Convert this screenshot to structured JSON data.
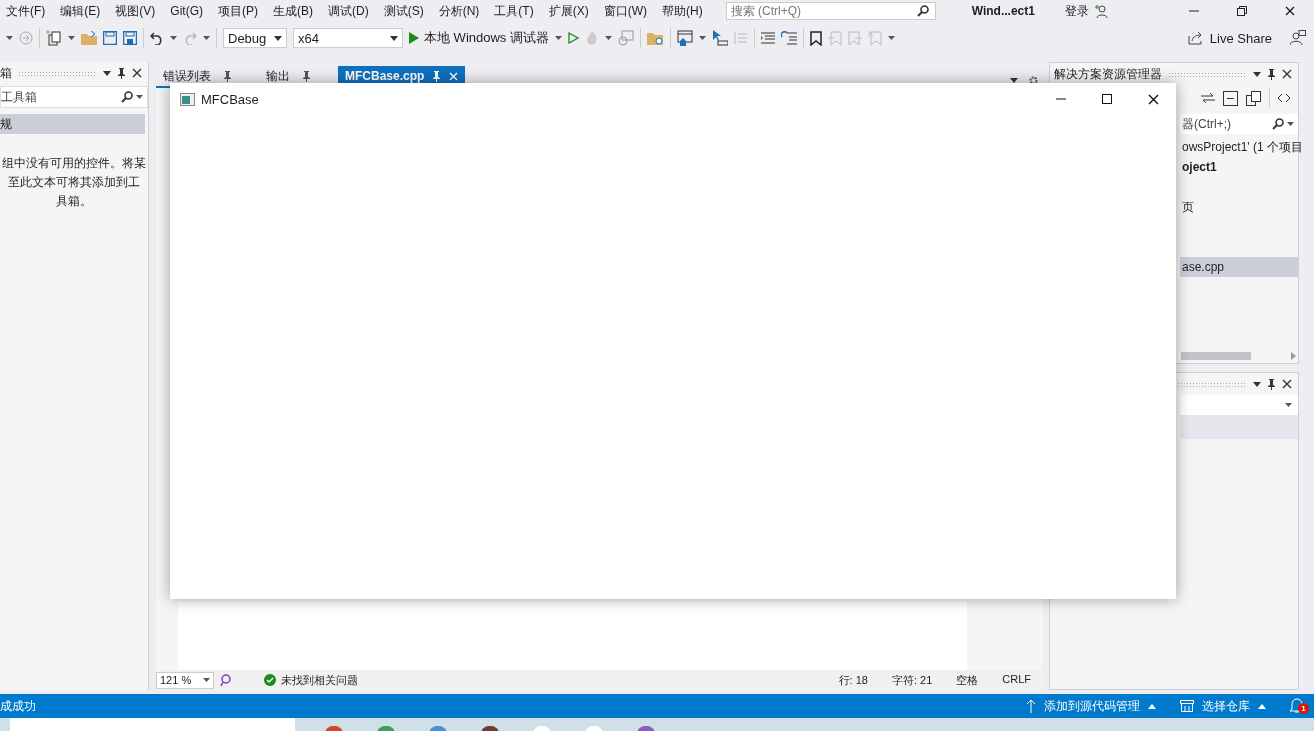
{
  "menu": [
    "文件(F)",
    "编辑(E)",
    "视图(V)",
    "Git(G)",
    "项目(P)",
    "生成(B)",
    "调试(D)",
    "测试(S)",
    "分析(N)",
    "工具(T)",
    "扩展(X)",
    "窗口(W)",
    "帮助(H)"
  ],
  "search": {
    "placeholder": "搜索 (Ctrl+Q)"
  },
  "window_title": "Wind...ect1",
  "sign_in": "登录",
  "toolbar": {
    "configuration": "Debug",
    "platform": "x64",
    "run": "本地 Windows 调试器",
    "live_share": "Live Share"
  },
  "toolbox": {
    "title": "箱",
    "search_placeholder": "工具箱",
    "group": "规",
    "message_lines": [
      "组中没有可用的控件。将某",
      "至此文本可将其添加到工",
      "具箱。"
    ]
  },
  "editor": {
    "tabs": [
      {
        "label": "错误列表",
        "selected": false
      },
      {
        "label": "输出",
        "selected": false
      },
      {
        "label": "MFCBase.cpp",
        "selected": true
      }
    ],
    "zoom": "121 %",
    "issues": "未找到相关问题",
    "line": "行: 18",
    "char": "字符: 21",
    "spacing": "空格",
    "line_ending": "CRLF"
  },
  "solution_explorer": {
    "title": "解决方案资源管理器",
    "search_placeholder": "器(Ctrl+;)",
    "items": [
      {
        "label": "owsProject1' (1 个项目",
        "bold": false,
        "selected": false
      },
      {
        "label": "oject1",
        "bold": true,
        "selected": false
      },
      {
        "label": "页",
        "bold": false,
        "selected": false
      },
      {
        "label": "ase.cpp",
        "bold": false,
        "selected": true
      }
    ]
  },
  "floating_window": {
    "title": "MFCBase"
  },
  "status_bar": {
    "message": "成成功",
    "source_control": "添加到源代码管理",
    "repository": "选择仓库",
    "notifications": "1"
  }
}
